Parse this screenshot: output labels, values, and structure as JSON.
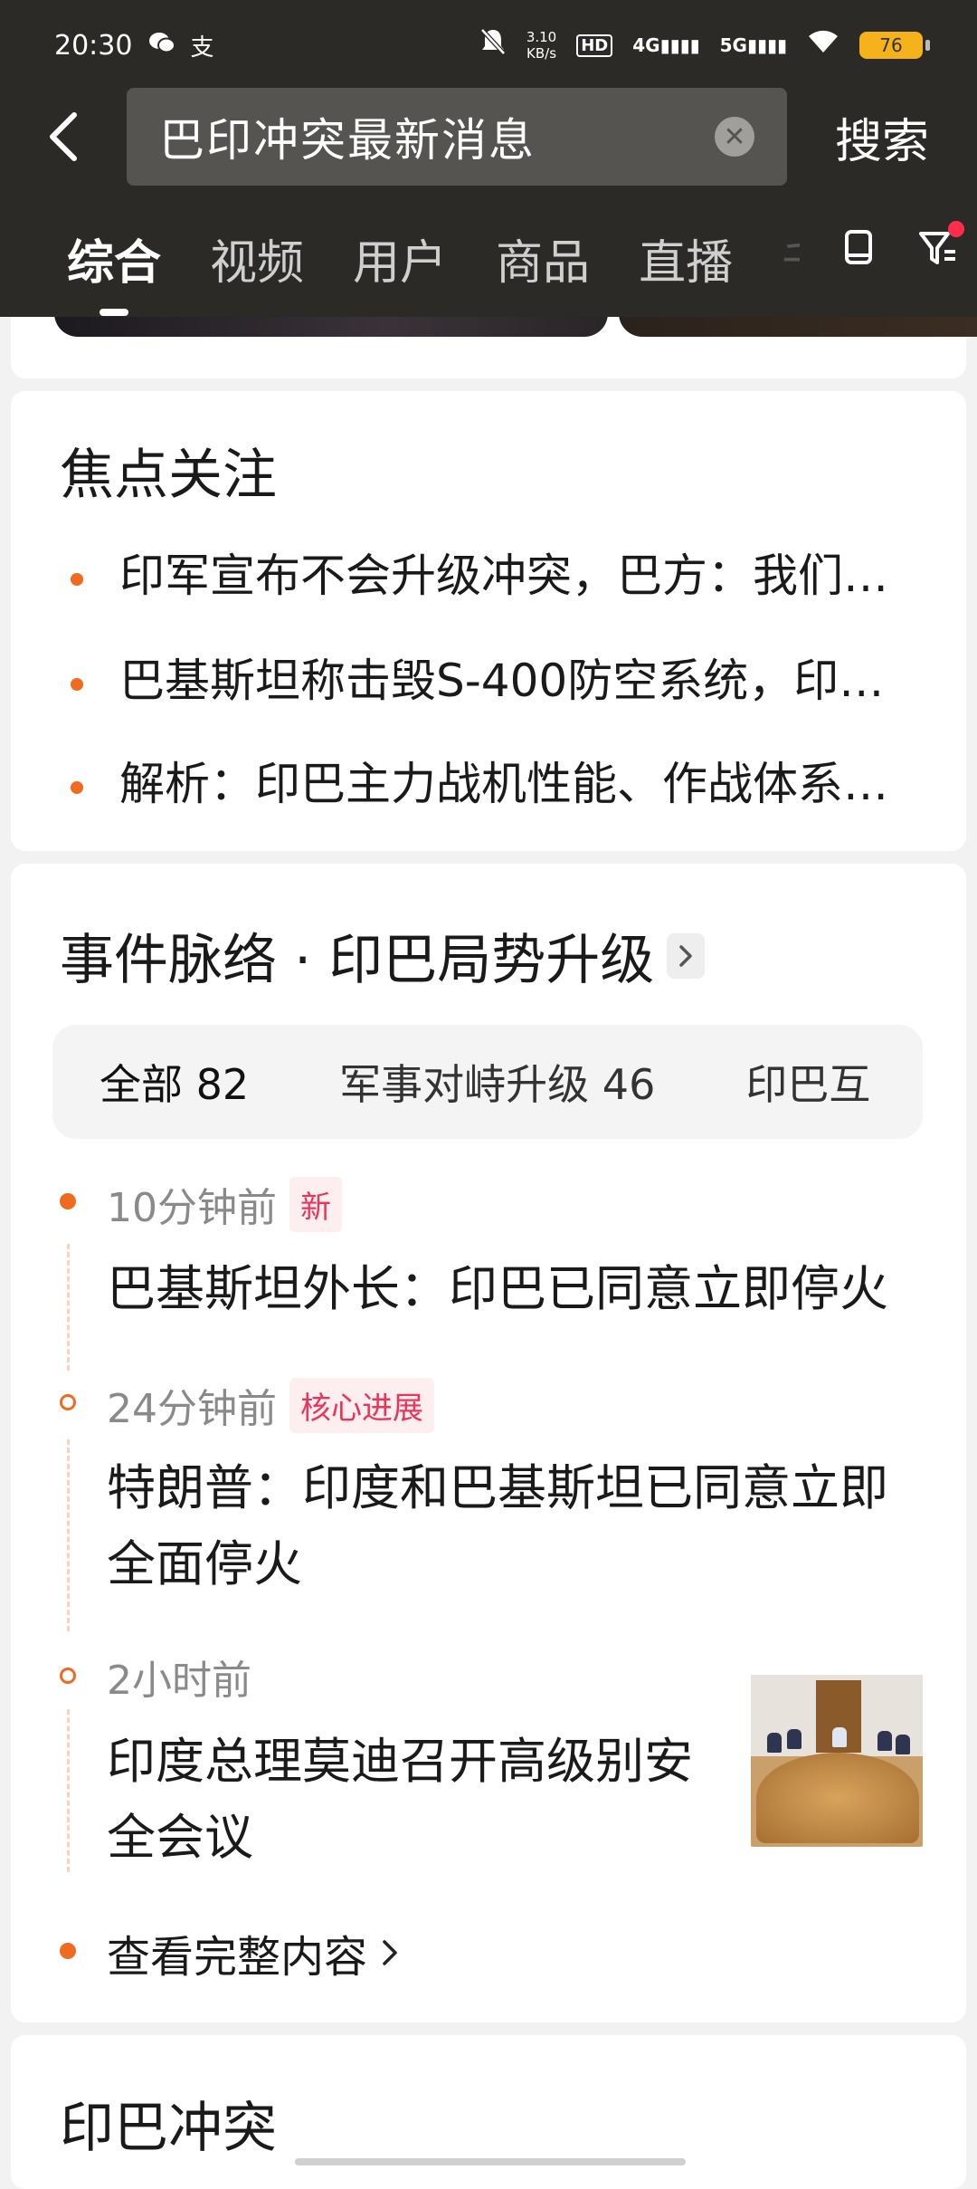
{
  "status_bar": {
    "time": "20:30",
    "net_speed_value": "3.10",
    "net_speed_unit": "KB/s",
    "hd_label": "HD",
    "sim1": "4G",
    "sim2": "5G",
    "battery": "76"
  },
  "search": {
    "query": "巴印冲突最新消息",
    "submit_label": "搜索"
  },
  "tabs": [
    {
      "label": "综合",
      "active": true
    },
    {
      "label": "视频"
    },
    {
      "label": "用户"
    },
    {
      "label": "商品"
    },
    {
      "label": "直播"
    },
    {
      "label": "千"
    }
  ],
  "focus": {
    "title": "焦点关注",
    "items": [
      "印军宣布不会升级冲突，巴方：我们…",
      "巴基斯坦称击毁S-400防空系统，印…",
      "解析：印巴主力战机性能、作战体系…"
    ]
  },
  "events": {
    "title": "事件脉络 · 印巴局势升级",
    "filters": [
      {
        "label": "全部",
        "count": "82",
        "active": true
      },
      {
        "label": "军事对峙升级",
        "count": "46"
      },
      {
        "label": "印巴互",
        "count": ""
      }
    ],
    "timeline": [
      {
        "time": "10分钟前",
        "tag": "新",
        "text_lines": [
          "巴基斯坦外长：印巴已同意立即停火"
        ]
      },
      {
        "time": "24分钟前",
        "tag": "核心进展",
        "text_lines": [
          "特朗普：印度和巴基斯坦已同意立即",
          "全面停火"
        ]
      },
      {
        "time": "2小时前",
        "tag": "",
        "text_lines": [
          "印度总理莫迪召开高级别安",
          "全会议"
        ]
      }
    ],
    "more_label": "查看完整内容"
  },
  "next_card": {
    "title": "印巴冲突"
  },
  "colors": {
    "header_bg": "#2b2a27",
    "accent_orange": "#f06a1f",
    "tag_red": "#e8365a",
    "battery": "#f5b21b"
  }
}
